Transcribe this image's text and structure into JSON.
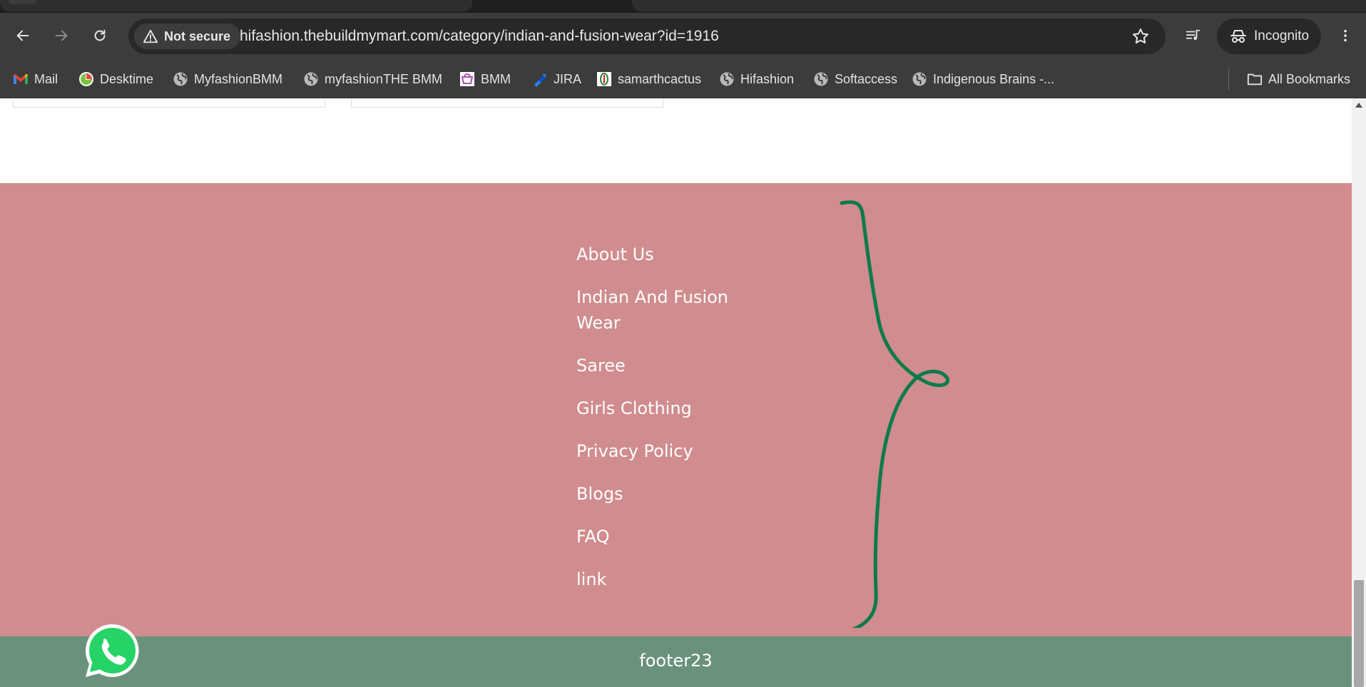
{
  "browser": {
    "security_label": "Not secure",
    "url": "hifashion.thebuildmymart.com/category/indian-and-fusion-wear?id=1916",
    "profile_label": "Incognito",
    "all_bookmarks_label": "All Bookmarks",
    "bookmarks": [
      {
        "label": "Mail",
        "icon": "gmail-icon"
      },
      {
        "label": "Desktime",
        "icon": "desktime-icon"
      },
      {
        "label": "MyfashionBMM",
        "icon": "globe-icon"
      },
      {
        "label": "myfashionTHE BMM",
        "icon": "globe-icon"
      },
      {
        "label": "BMM",
        "icon": "bmm-icon"
      },
      {
        "label": "JIRA",
        "icon": "jira-icon"
      },
      {
        "label": "samarthcactus",
        "icon": "cactus-icon"
      },
      {
        "label": "Hifashion",
        "icon": "globe-icon"
      },
      {
        "label": "Softaccess",
        "icon": "globe-icon"
      },
      {
        "label": "Indigenous Brains -...",
        "icon": "globe-icon"
      }
    ]
  },
  "footer": {
    "links": [
      "About Us",
      "Indian And Fusion Wear",
      "Saree",
      "Girls Clothing",
      "Privacy Policy",
      "Blogs",
      "FAQ",
      "link"
    ],
    "copyright": "footer23"
  },
  "colors": {
    "footer_background": "#d08c8e",
    "footer_bottom_background": "#6a917b",
    "annotation_brace": "#0c7a4a",
    "whatsapp_green": "#25d366"
  }
}
